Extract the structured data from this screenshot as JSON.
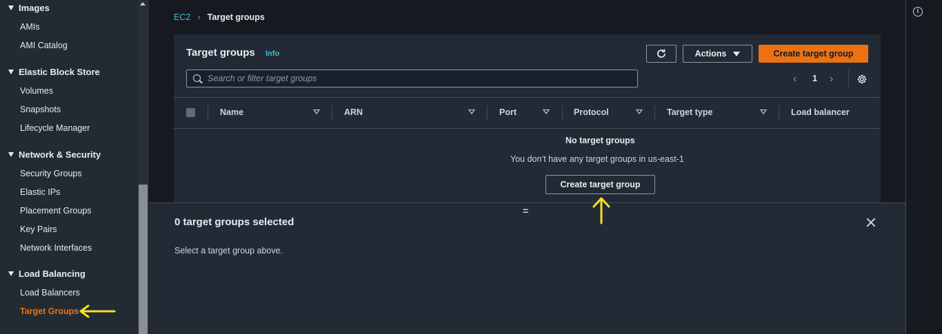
{
  "sidebar": {
    "sections": [
      {
        "label": "Images",
        "items": [
          "AMIs",
          "AMI Catalog"
        ]
      },
      {
        "label": "Elastic Block Store",
        "items": [
          "Volumes",
          "Snapshots",
          "Lifecycle Manager"
        ]
      },
      {
        "label": "Network & Security",
        "items": [
          "Security Groups",
          "Elastic IPs",
          "Placement Groups",
          "Key Pairs",
          "Network Interfaces"
        ]
      },
      {
        "label": "Load Balancing",
        "items": [
          "Load Balancers",
          "Target Groups"
        ]
      }
    ],
    "active_item": "Target Groups"
  },
  "breadcrumb": {
    "root": "EC2",
    "current": "Target groups"
  },
  "panel": {
    "title": "Target groups",
    "info": "Info",
    "actions_label": "Actions",
    "create_label": "Create target group",
    "search_placeholder": "Search or filter target groups",
    "page": "1",
    "columns": [
      "Name",
      "ARN",
      "Port",
      "Protocol",
      "Target type",
      "Load balancer"
    ],
    "empty_title": "No target groups",
    "empty_desc": "You don’t have any target groups in us-east-1",
    "empty_button": "Create target group"
  },
  "split_panel": {
    "title": "0 target groups selected",
    "desc": "Select a target group above."
  },
  "colors": {
    "accent": "#ec7211",
    "link": "#44b9d6",
    "annotation": "#f5e027"
  },
  "icons": [
    "refresh-icon",
    "search-icon",
    "gear-icon",
    "close-icon",
    "info-icon"
  ]
}
